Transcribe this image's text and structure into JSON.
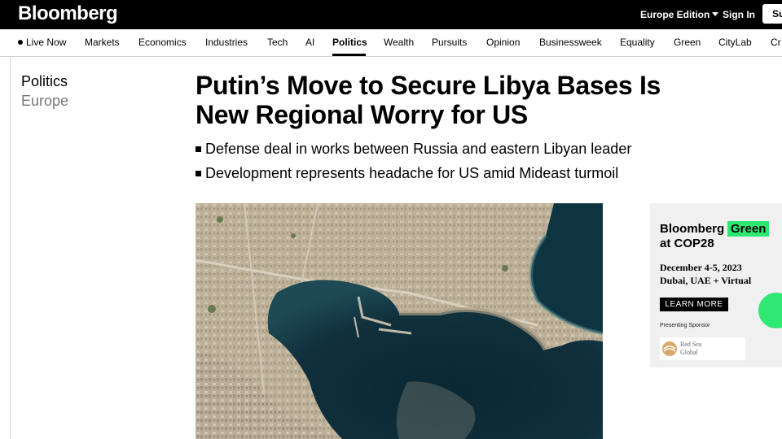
{
  "header": {
    "logo": "Bloomberg",
    "edition": "Europe Edition",
    "sign_in": "Sign In",
    "subscribe": "Su"
  },
  "nav": {
    "items": [
      {
        "label": "Live Now"
      },
      {
        "label": "Markets"
      },
      {
        "label": "Economics"
      },
      {
        "label": "Industries"
      },
      {
        "label": "Tech"
      },
      {
        "label": "AI"
      },
      {
        "label": "Politics"
      },
      {
        "label": "Wealth"
      },
      {
        "label": "Pursuits"
      },
      {
        "label": "Opinion"
      },
      {
        "label": "Businessweek"
      },
      {
        "label": "Equality"
      },
      {
        "label": "Green"
      },
      {
        "label": "CityLab"
      },
      {
        "label": "Cr"
      }
    ],
    "active": "Politics"
  },
  "article": {
    "section": "Politics",
    "region": "Europe",
    "headline": "Putin’s Move to Secure Libya Bases Is New Regional Worry for US",
    "bullets": [
      "Defense deal in works between Russia and eastern Libyan leader",
      "Development represents headache for US amid Mideast turmoil"
    ]
  },
  "ad": {
    "brand": "Bloomberg",
    "brand_green": "Green",
    "event": "at COP28",
    "date": "December 4-5, 2023",
    "location": "Dubai, UAE + Virtual",
    "cta": "LEARN MORE",
    "presenting": "Presenting Sponsor",
    "sponsor_line1": "Red Sea",
    "sponsor_line2": "Global"
  },
  "colors": {
    "header_bg": "#000000",
    "accent_green": "#2ee872",
    "sea_dark": "#0d2a35"
  }
}
